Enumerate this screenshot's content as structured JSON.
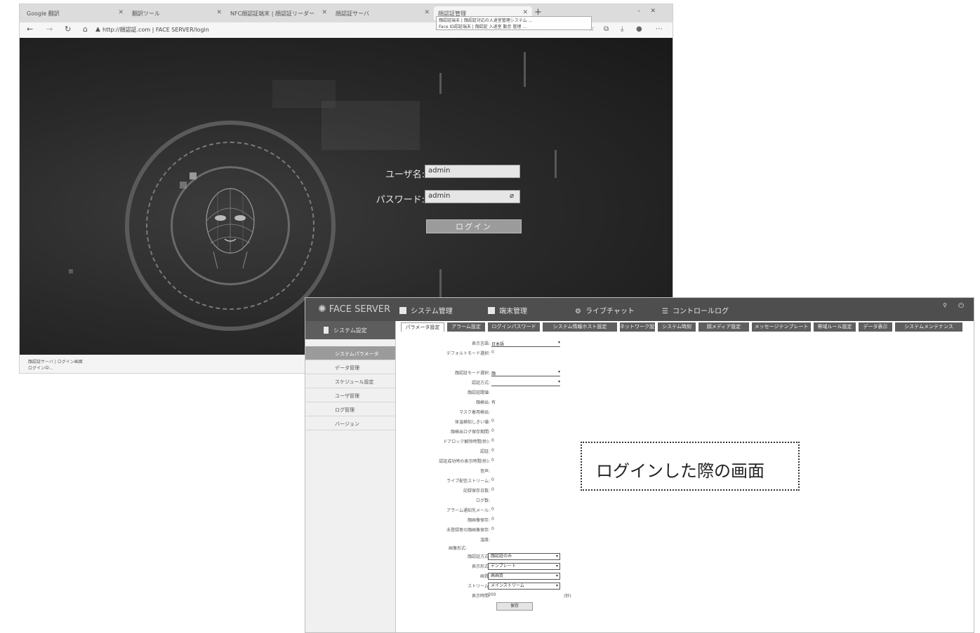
{
  "browser": {
    "tabs": [
      "Google 翻訳",
      "翻訳ツール",
      "NFC顔認証端末 | 顔認証リーダー",
      "顔認証サーバ",
      "顔認証管理"
    ],
    "tooltip": [
      "顔認証端末 | 顔認証対応の入退室管理システム  ...",
      "Face ID認証端末 | 顔認証 入退室 勤怠 管理  ..."
    ],
    "url": "http://顔認証.com | FACE SERVER/login",
    "status": [
      "顔認証サーバ | ログイン画面",
      "ログイン中..."
    ]
  },
  "login": {
    "username_label": "ユーザ名:",
    "username_value": "admin",
    "password_label": "パスワード:",
    "password_value": "admin",
    "button": "ログイン"
  },
  "app": {
    "logo": "FACE SERVER",
    "nav": [
      "システム管理",
      "端末管理",
      "ライブチャット",
      "コントロールログ"
    ],
    "sidebar_title": "システム設定",
    "sidebar_items": [
      "システムパラメータ",
      "データ管理",
      "スケジュール設定",
      "ユーザ管理",
      "ログ管理",
      "バージョン"
    ],
    "subtabs": [
      "パラメータ設定",
      "アラーム設定",
      "ログインパスワード",
      "システム情報ホスト設定",
      "ネットワーク設定",
      "システム時刻",
      "顔メディア設定",
      "メッセージテンプレート",
      "帯域ルール設定",
      "データ表示",
      "システムメンテナンス"
    ],
    "form_rows": [
      {
        "label": "表示言語:",
        "value": "日本語",
        "kind": "select"
      },
      {
        "label": "デフォルトモード選択:",
        "value": "0",
        "kind": "text"
      },
      {
        "label": "",
        "value": "",
        "kind": "text"
      },
      {
        "label": "顔認証モード選択:",
        "value": "顔",
        "kind": "select"
      },
      {
        "label": "認証方式:",
        "value": "",
        "kind": "select"
      },
      {
        "label": "顔認証閾値:",
        "value": "",
        "kind": "text"
      },
      {
        "label": "顔検出:",
        "value": "有",
        "kind": "text"
      },
      {
        "label": "マスク着用検出:",
        "value": "",
        "kind": "text"
      },
      {
        "label": "体温検知しきい値:",
        "value": "0",
        "kind": "text"
      },
      {
        "label": "顔検出ログ保存期間:",
        "value": "0",
        "kind": "text"
      },
      {
        "label": "ドアロック解除時間(秒):",
        "value": "0",
        "kind": "text"
      },
      {
        "label": "認証:",
        "value": "0",
        "kind": "text"
      },
      {
        "label": "認証成功時の表示時間(秒):",
        "value": "0",
        "kind": "text"
      },
      {
        "label": "音声:",
        "value": "",
        "kind": "text"
      },
      {
        "label": "ライブ配信ストリーム:",
        "value": "0",
        "kind": "text"
      },
      {
        "label": "記録保存日数:",
        "value": "0",
        "kind": "text"
      },
      {
        "label": "ログ数:",
        "value": "",
        "kind": "text"
      },
      {
        "label": "アラーム通知先メール:",
        "value": "0",
        "kind": "text"
      },
      {
        "label": "顔画像保存:",
        "value": "0",
        "kind": "text"
      },
      {
        "label": "未登録者の顔画像保存:",
        "value": "0",
        "kind": "text"
      },
      {
        "label": "温度:",
        "value": "",
        "kind": "text"
      },
      {
        "label": "画像形式:",
        "value": "",
        "kind": "text"
      }
    ],
    "select_rows": [
      {
        "label": "顔認証方式:",
        "value": "顔認証のみ"
      },
      {
        "label": "表示形式:",
        "value": "テンプレート"
      },
      {
        "label": "画質:",
        "value": "高画質"
      },
      {
        "label": "ストリーム:",
        "value": "メインストリーム"
      }
    ],
    "last_row": {
      "label": "表示時間:",
      "value": "300",
      "unit": "(秒)"
    },
    "save_button": "保存"
  },
  "callout": "ログインした際の画面"
}
